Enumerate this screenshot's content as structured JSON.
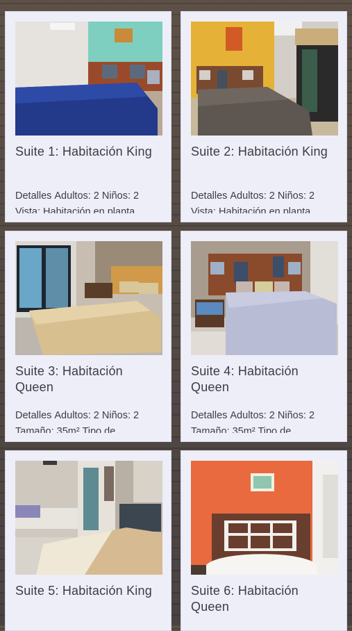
{
  "suites": [
    {
      "title": "Suite 1: Habitación King",
      "details_label": "Detalles",
      "adults": "Adultos: 2",
      "kids": "Niños: 2",
      "line2": "Vista: Habitación en planta"
    },
    {
      "title": "Suite 2: Habitación King",
      "details_label": "Detalles",
      "adults": "Adultos: 2",
      "kids": "Niños: 2",
      "line2": "Vista: Habitación en planta"
    },
    {
      "title": "Suite 3: Habitación Queen",
      "details_label": "Detalles",
      "adults": "Adultos: 2",
      "kids": "Niños: 2",
      "line2": "Tamaño: 35m² Tipo de"
    },
    {
      "title": "Suite 4: Habitación Queen",
      "details_label": "Detalles",
      "adults": "Adultos: 2",
      "kids": "Niños: 2",
      "line2": "Tamaño: 35m² Tipo de"
    },
    {
      "title": "Suite 5: Habitación King",
      "details_label": "",
      "adults": "",
      "kids": "",
      "line2": ""
    },
    {
      "title": "Suite 6: Habitación Queen",
      "details_label": "",
      "adults": "",
      "kids": "",
      "line2": ""
    }
  ]
}
